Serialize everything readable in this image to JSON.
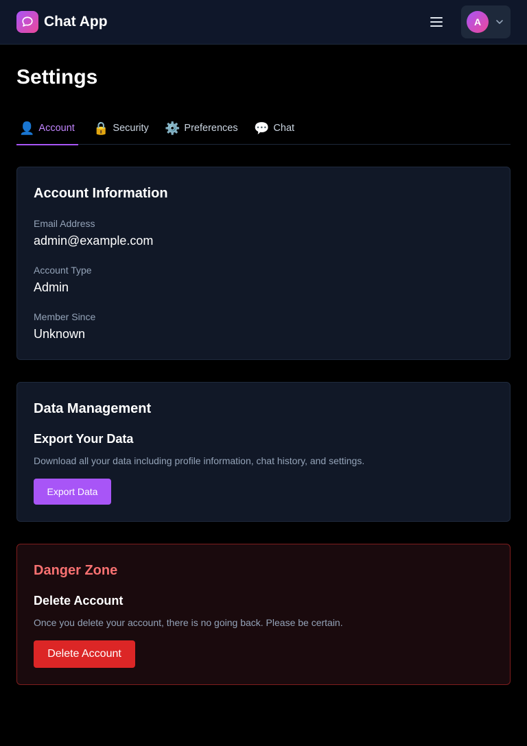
{
  "header": {
    "app_title": "Chat App",
    "logo_icon": "chat-bubble-icon",
    "menu_icon": "hamburger-icon",
    "avatar_initial": "A",
    "dropdown_icon": "chevron-down-icon",
    "accent_gradient": [
      "#a855f7",
      "#ec4899"
    ]
  },
  "page": {
    "title": "Settings"
  },
  "tabs": [
    {
      "icon": "👤",
      "label": "Account",
      "active": true
    },
    {
      "icon": "🔒",
      "label": "Security",
      "active": false
    },
    {
      "icon": "⚙️",
      "label": "Preferences",
      "active": false
    },
    {
      "icon": "💬",
      "label": "Chat",
      "active": false
    }
  ],
  "account_info": {
    "title": "Account Information",
    "fields": [
      {
        "label": "Email Address",
        "value": "admin@example.com"
      },
      {
        "label": "Account Type",
        "value": "Admin"
      },
      {
        "label": "Member Since",
        "value": "Unknown"
      }
    ]
  },
  "data_management": {
    "title": "Data Management",
    "section_title": "Export Your Data",
    "description": "Download all your data including profile information, chat history, and settings.",
    "button_label": "Export Data",
    "button_color": "#a855f7"
  },
  "danger_zone": {
    "title": "Danger Zone",
    "section_title": "Delete Account",
    "description": "Once you delete your account, there is no going back. Please be certain.",
    "button_label": "Delete Account",
    "button_color": "#dc2626",
    "title_color": "#f87171"
  }
}
